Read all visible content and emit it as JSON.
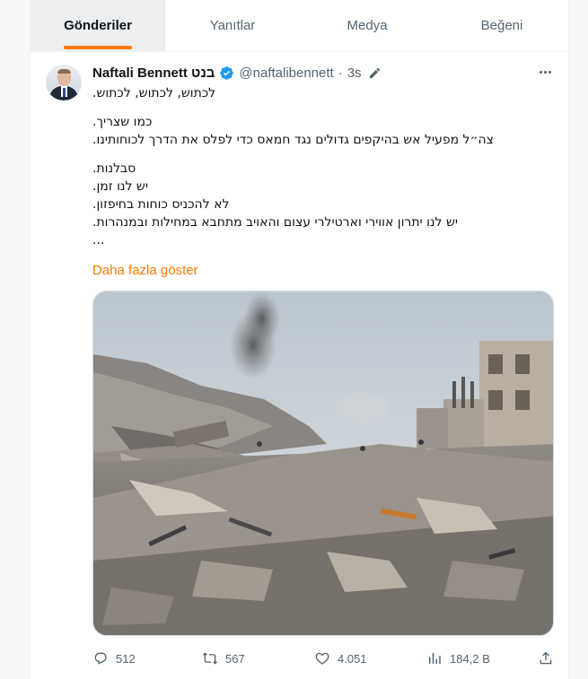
{
  "tabs": [
    {
      "label": "Gönderiler",
      "active": true
    },
    {
      "label": "Yanıtlar",
      "active": false
    },
    {
      "label": "Medya",
      "active": false
    },
    {
      "label": "Beğeni",
      "active": false
    }
  ],
  "tweet": {
    "author_name": "Naftali Bennett בנט",
    "handle": "@naftalibennett",
    "separator": "·",
    "time": "3s",
    "lines": [
      "לכתוש, לכתוש, לכתוש.",
      "",
      "כמו שצריך.",
      "צה״ל מפעיל אש בהיקפים גדולים נגד חמאס כדי לפלס את הדרך לכוחותינו.",
      "",
      "סבלנות.",
      "יש לנו זמן.",
      "לא להכניס כוחות בחיפזון.",
      "יש לנו יתרון אווירי וארטילרי עצום והאויב מתחבא במחילות ובמנהרות.",
      "..."
    ],
    "show_more": "Daha fazla göster",
    "replies": "512",
    "reposts": "567",
    "likes": "4.051",
    "views": "184,2 B"
  },
  "colors": {
    "accent": "#ff7a00",
    "verified": "#1d9bf0",
    "muted": "#536471"
  },
  "icons": [
    "verified-badge-icon",
    "edit-icon",
    "more-icon",
    "reply-icon",
    "repost-icon",
    "like-icon",
    "views-icon",
    "share-icon"
  ]
}
